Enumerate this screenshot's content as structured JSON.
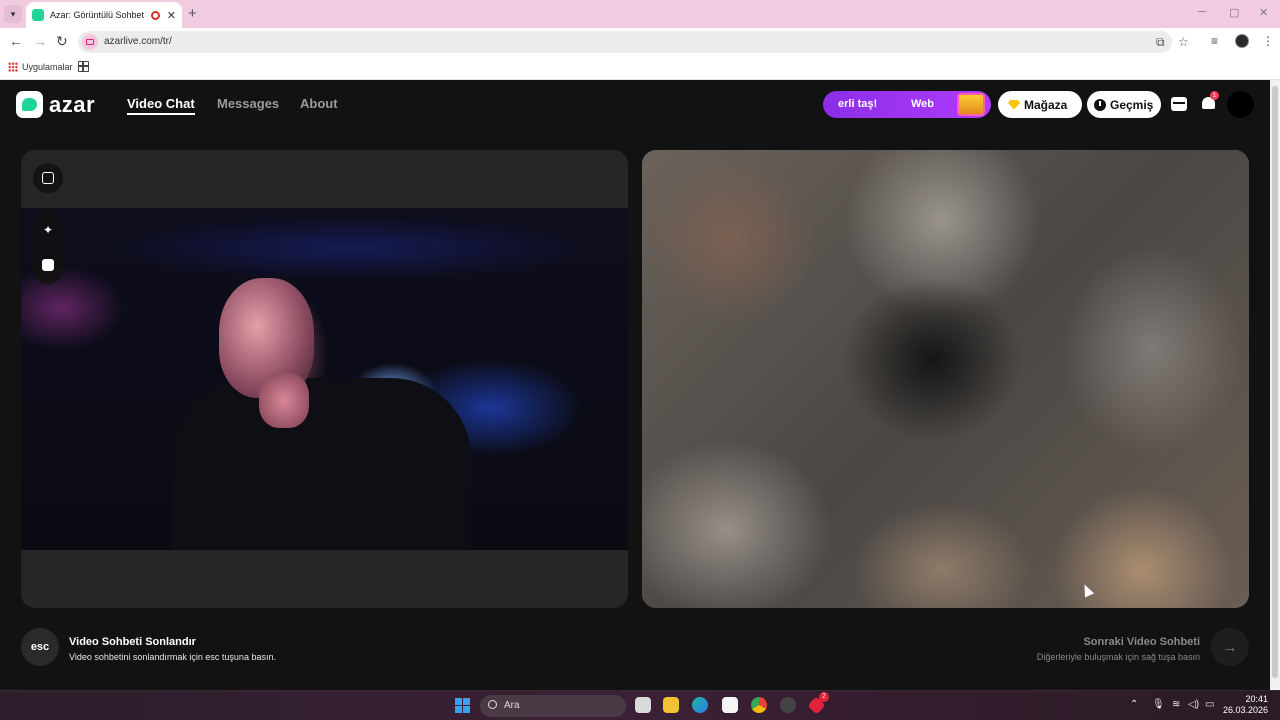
{
  "browser": {
    "tab_title": "Azar: Görüntülü Sohbet & V",
    "tab_close": "✕",
    "new_tab": "+",
    "url": "azarlive.com/tr/",
    "bookmarks": {
      "apps_label": "Uygulamalar"
    },
    "window_controls": [
      "─",
      "▢",
      "✕"
    ]
  },
  "header": {
    "logo_text": "azar",
    "nav": [
      {
        "label": "Video Chat",
        "active": true
      },
      {
        "label": "Messages",
        "active": false
      },
      {
        "label": "About",
        "active": false
      }
    ],
    "promo": {
      "text_a": "erli taş!",
      "text_b": "Web"
    },
    "shop_label": "Mağaza",
    "history_label": "Geçmiş",
    "notification_count": "1"
  },
  "controls": {
    "esc_key": "esc",
    "end_title": "Video Sohbeti Sonlandır",
    "end_subtitle": "Video sohbetini sonlandırmak için esc tuşuna basın.",
    "next_title": "Sonraki Video Sohbeti",
    "next_subtitle": "Diğerleriyle buluşmak için sağ tuşa basın",
    "next_arrow": "→"
  },
  "taskbar": {
    "search_label": "Ara",
    "time": "20:41",
    "date": "26.03.2026",
    "badge_count": "2"
  },
  "colors": {
    "accent_green": "#1ed49a",
    "promo_purple": "#8b2ee6",
    "page_bg": "#121212"
  }
}
